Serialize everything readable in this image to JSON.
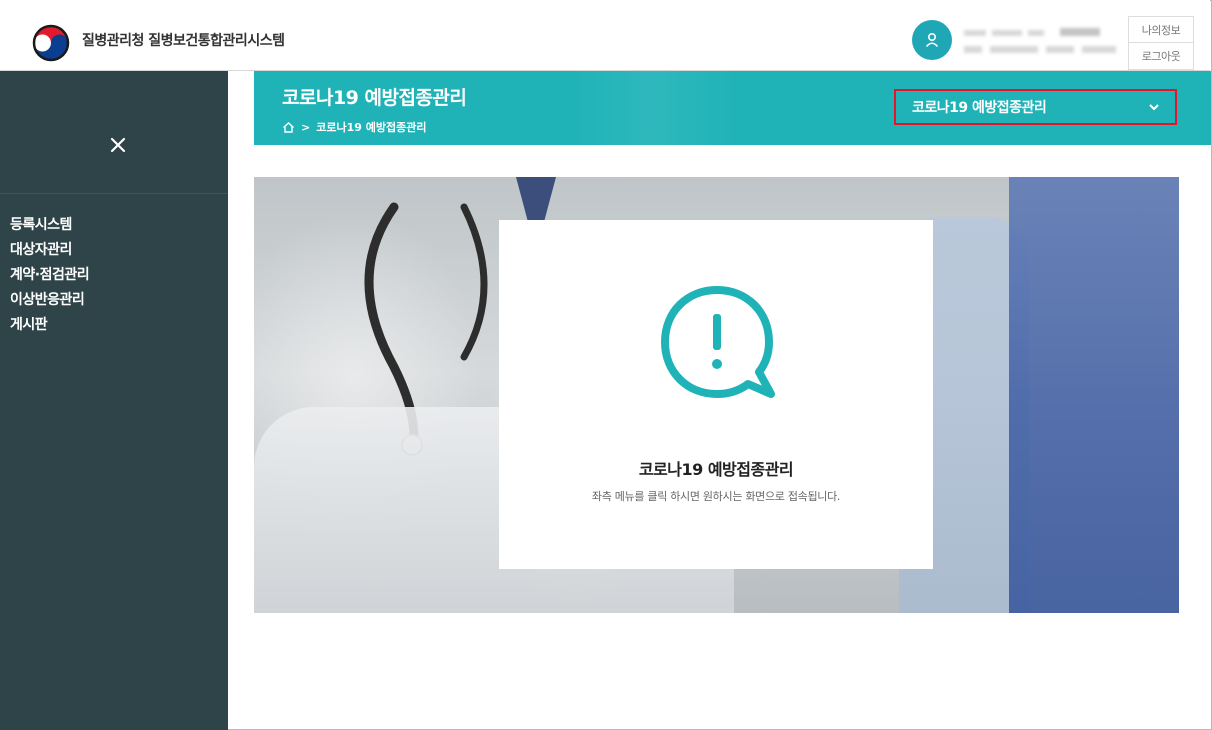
{
  "header": {
    "site_title": "질병관리청 질병보건통합관리시스템",
    "my_info_label": "나의정보",
    "logout_label": "로그아웃",
    "user_icon": "user-icon"
  },
  "sidebar": {
    "close_icon": "close-icon",
    "items": [
      {
        "label": "등록시스템"
      },
      {
        "label": "대상자관리"
      },
      {
        "label": "계약·점검관리"
      },
      {
        "label": "이상반응관리"
      },
      {
        "label": "게시판"
      }
    ]
  },
  "banner": {
    "title": "코로나19 예방접종관리",
    "breadcrumb_home_icon": "home-icon",
    "breadcrumb_separator": ">",
    "breadcrumb_current": "코로나19 예방접종관리",
    "dropdown_selected": "코로나19 예방접종관리",
    "dropdown_icon": "chevron-down-icon",
    "highlight_color": "#e4152b"
  },
  "card": {
    "icon": "exclamation-speech-bubble-icon",
    "title": "코로나19 예방접종관리",
    "description": "좌측 메뉴를 클릭 하시면 원하시는 화면으로 접속됩니다."
  },
  "colors": {
    "accent": "#1fb3b8",
    "sidebar_bg": "#2f4449"
  }
}
